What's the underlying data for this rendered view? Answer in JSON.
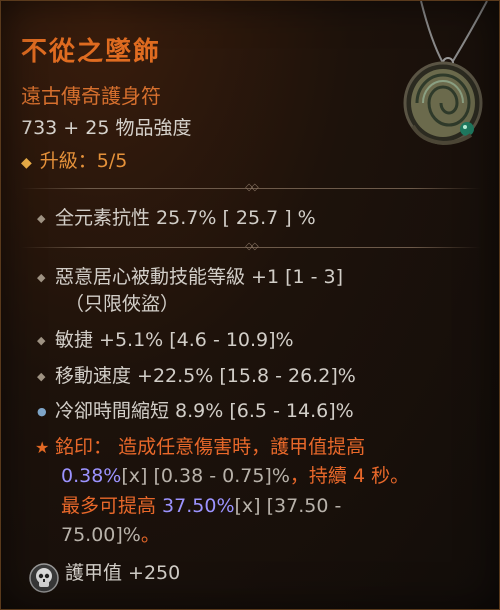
{
  "item": {
    "name": "不從之墜飾",
    "type": "遠古傳奇護身符",
    "item_power": "733 + 25 物品強度",
    "upgrade": "升級：5/5"
  },
  "implicit": {
    "text": "全元素抗性 25.7%  [ 25.7 ] %"
  },
  "affixes": [
    {
      "line1": "惡意居心被動技能等級 +1 [1 - 3]",
      "line2": "（只限俠盜）"
    },
    {
      "text": "敏捷 +5.1% [4.6 - 10.9]%"
    },
    {
      "text": "移動速度 +22.5% [15.8 - 26.2]%"
    },
    {
      "text": "冷卻時間縮短 8.9% [6.5 - 14.6]%"
    }
  ],
  "aspect": {
    "label": "銘印：",
    "l1_red": "造成任意傷害時，護甲值提高",
    "l2_blue": "0.38%",
    "l2_x": "[x]",
    "l2_gray": " [0.38 - 0.75]%",
    "l2_red": "，持續 4 秒。",
    "l3_red": "最多可提高 ",
    "l3_blue": "37.50%",
    "l3_x": "[x]",
    "l3_gray": " [37.50 -",
    "l4_gray": "75.00]%",
    "l4_red": "。"
  },
  "armor": {
    "text": "護甲值 +250"
  },
  "colors": {
    "legendary_orange": "#e06c21",
    "value_blue": "#9c93ff"
  },
  "icons": [
    "amulet-icon",
    "armor-skull-icon",
    "diamond-bullet-icon",
    "star-bullet-icon"
  ]
}
